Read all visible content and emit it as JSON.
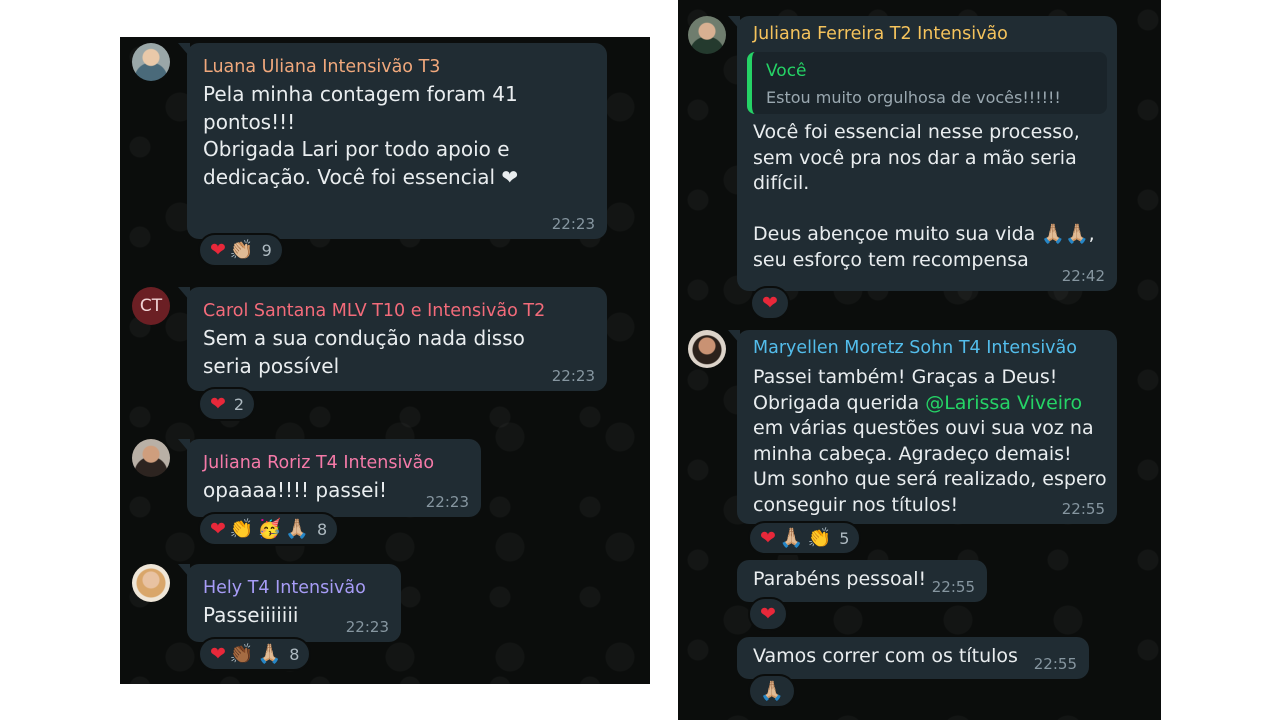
{
  "left": {
    "messages": [
      {
        "sender": "Luana Uliana Intensivão T3",
        "sender_color": "#f0a87c",
        "text": "Pela minha contagem foram 41\npontos!!!\nObrigada Lari por todo apoio e\ndedicação. Você foi essencial ❤",
        "time": "22:23",
        "reactions": [
          "❤",
          "👏🏼"
        ],
        "reaction_count": "9"
      },
      {
        "sender": "Carol Santana MLV T10 e Intensivão T2",
        "sender_color": "#f36b7a",
        "avatar_initials": "CT",
        "text": "Sem a sua condução nada disso\nseria possível",
        "time": "22:23",
        "reactions": [
          "❤"
        ],
        "reaction_count": "2"
      },
      {
        "sender": "Juliana Roriz T4 Intensivão",
        "sender_color": "#f57aa8",
        "text": "opaaaa!!!! passei!",
        "time": "22:23",
        "reactions": [
          "❤",
          "👏",
          "🥳",
          "🙏🏼"
        ],
        "reaction_count": "8"
      },
      {
        "sender": "Hely T4 Intensivão",
        "sender_color": "#a79cf6",
        "text": "Passeiiiiiii",
        "time": "22:23",
        "reactions": [
          "❤",
          "👏🏾",
          "🙏🏼"
        ],
        "reaction_count": "8"
      }
    ]
  },
  "right": {
    "messages": [
      {
        "sender": "Juliana Ferreira T2 Intensivão",
        "sender_color": "#f5c35c",
        "quote": {
          "name": "Você",
          "text": "Estou muito orgulhosa de vocês!!!!!!"
        },
        "text": "Você foi essencial nesse processo,\nsem você pra nos dar a mão seria\ndifícil.\n\nDeus abençoe muito sua vida 🙏🏼🙏🏼,\nseu esforço tem recompensa",
        "time": "22:42",
        "reactions": [
          "❤"
        ]
      },
      {
        "sender": "Maryellen Moretz Sohn T4 Intensivão",
        "sender_color": "#53bdeb",
        "text_before": "Passei também! Graças a Deus!\nObrigada querida ",
        "mention": "@Larissa Viveiro",
        "text_after": "\nem várias questões ouvi sua voz na\nminha cabeça. Agradeço demais!\nUm sonho que será realizado, espero\nconseguir nos títulos!",
        "time": "22:55",
        "reactions": [
          "❤",
          "🙏🏼",
          "👏"
        ],
        "reaction_count": "5"
      },
      {
        "text": "Parabéns pessoal!",
        "time": "22:55",
        "reactions": [
          "❤"
        ]
      },
      {
        "text": "Vamos correr com os títulos",
        "time": "22:55",
        "reactions": [
          "🙏🏼"
        ]
      }
    ]
  }
}
